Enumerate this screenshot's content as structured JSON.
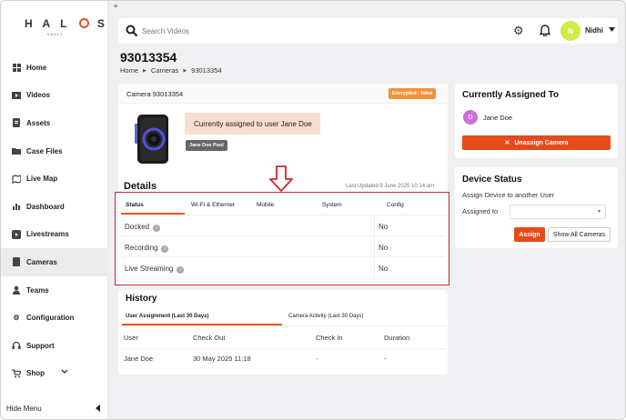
{
  "app": {
    "brand": "HALOS",
    "brand_sub": "VAULT",
    "menu_glyph": "≡"
  },
  "sidebar": {
    "items": [
      {
        "label": "Home",
        "icon": "grid-icon"
      },
      {
        "label": "Videos",
        "icon": "video-icon"
      },
      {
        "label": "Assets",
        "icon": "document-icon"
      },
      {
        "label": "Case Files",
        "icon": "folder-icon"
      },
      {
        "label": "Live Map",
        "icon": "map-icon"
      },
      {
        "label": "Dashboard",
        "icon": "chart-icon"
      },
      {
        "label": "Livestreams",
        "icon": "play-icon"
      },
      {
        "label": "Cameras",
        "icon": "camera-icon",
        "active": true
      },
      {
        "label": "Teams",
        "icon": "person-icon"
      },
      {
        "label": "Configuration",
        "icon": "gear-icon"
      },
      {
        "label": "Support",
        "icon": "headset-icon"
      },
      {
        "label": "Shop",
        "icon": "cart-icon"
      }
    ],
    "hide_menu": "Hide Menu"
  },
  "topbar": {
    "search_placeholder": "Search Videos",
    "user_initial": "N",
    "user_name": "Nidhi"
  },
  "page": {
    "title": "93013354",
    "breadcrumb": [
      "Home",
      "Cameras",
      "93013354"
    ]
  },
  "camera": {
    "header": "Camera 93013354",
    "encrypted_badge": "Encrypted : false",
    "assigned_text": "Currently assigned to user Jane Doe",
    "pool_badge": "Jane Doe Pool"
  },
  "details": {
    "title": "Details",
    "last_updated": "Last Updated 9 June 2025 10:14 am",
    "tabs": [
      "Status",
      "Wi-Fi & Ethernet",
      "Mobile",
      "System",
      "Config"
    ],
    "active_tab": "Status",
    "rows": [
      {
        "label": "Docked",
        "value": "No"
      },
      {
        "label": "Recording",
        "value": "No"
      },
      {
        "label": "Live Streaming",
        "value": "No"
      }
    ]
  },
  "history": {
    "title": "History",
    "tabs": [
      "User Assignment (Last 30 Days)",
      "Camera Activity (Last 30 Days)"
    ],
    "columns": [
      "User",
      "Check Out",
      "Check In",
      "Duration"
    ],
    "rows": [
      [
        "Jane Doe",
        "30 May 2025 11:18",
        "-",
        "-"
      ]
    ]
  },
  "current": {
    "title": "Currently Assigned To",
    "avatar_initial": "D",
    "user": "Jane Doe",
    "unassign_label": "Unassign Camera"
  },
  "device_status": {
    "title": "Device Status",
    "subtitle": "Assign Device to another User",
    "assigned_to_label": "Assigned to",
    "assign_label": "Assign",
    "show_all_label": "Show All Cameras"
  },
  "colors": {
    "accent": "#e64a19",
    "encrypted": "#f2923a",
    "annotation_red": "#d0262b",
    "avatar_user": "#d4e94a",
    "avatar_assignee": "#c970d6"
  }
}
